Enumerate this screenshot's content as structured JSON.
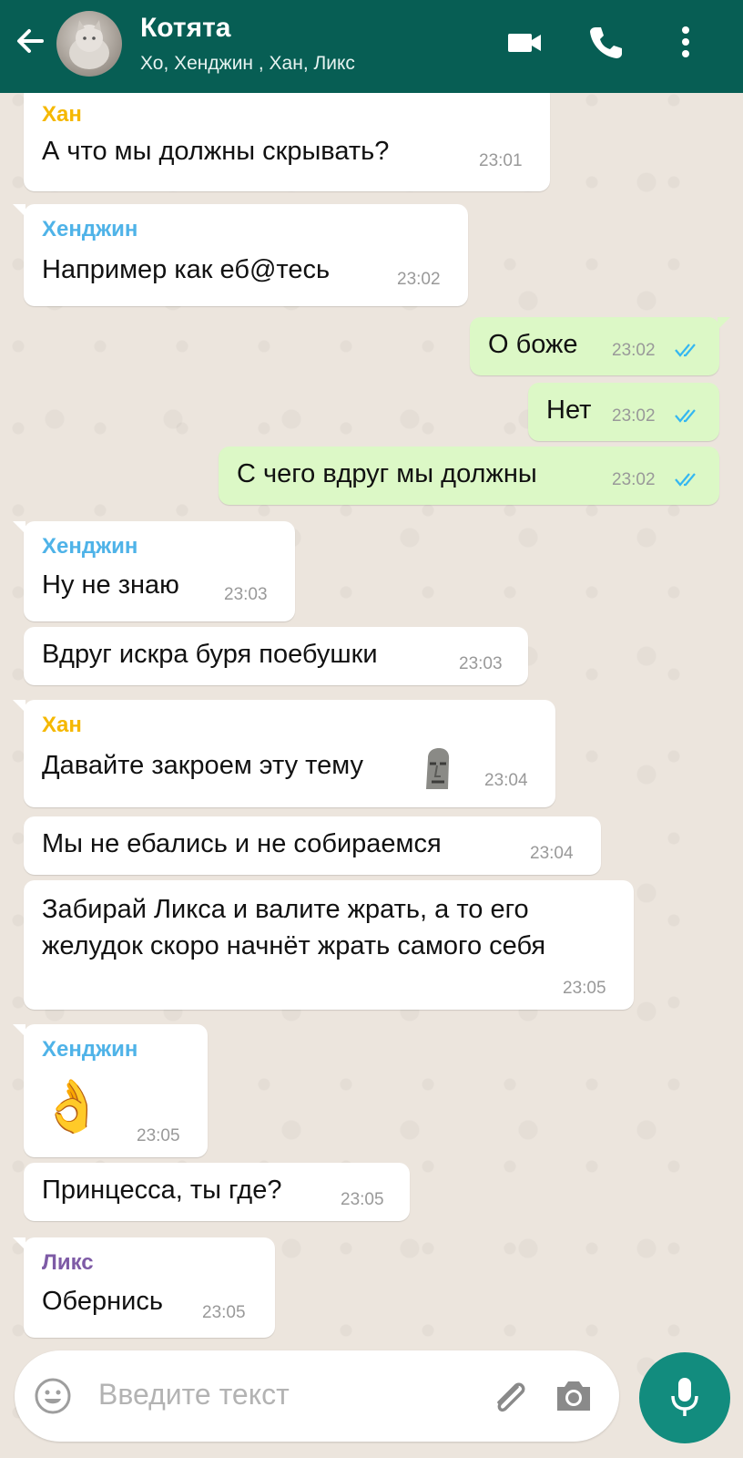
{
  "header": {
    "title": "Котята",
    "subtitle": "Хо, Хенджин , Хан, Ликс"
  },
  "colors": {
    "header": "#075E54",
    "outgoing": "#DCF8C6",
    "incoming": "#FFFFFF",
    "han": "#F5B800",
    "hyunjin": "#4FB3E8",
    "lix": "#7E5BA6",
    "read_ticks": "#34B7F1",
    "mic": "#128C7E"
  },
  "messages": [
    {
      "sender": "Хан",
      "text": "А что мы должны скрывать?",
      "time": "23:01"
    },
    {
      "sender": "Хенджин",
      "text": "Например как еб@тесь",
      "time": "23:02"
    },
    {
      "text": "О боже",
      "time": "23:02"
    },
    {
      "text": "Нет",
      "time": "23:02"
    },
    {
      "text": "С чего вдруг мы должны",
      "time": "23:02"
    },
    {
      "sender": "Хенджин",
      "text": "Ну не знаю",
      "time": "23:03"
    },
    {
      "text": "Вдруг искра буря поебушки",
      "time": "23:03"
    },
    {
      "sender": "Хан",
      "text": "Давайте закроем эту тему",
      "time": "23:04"
    },
    {
      "text": "Мы не ебались и не собираемся",
      "time": "23:04"
    },
    {
      "text": "Забирай Ликса и валите жрать, а то его желудок скоро начнёт жрать самого себя",
      "time": "23:05"
    },
    {
      "sender": "Хенджин",
      "emoji": "👌",
      "time": "23:05"
    },
    {
      "text": "Принцесса, ты где?",
      "time": "23:05"
    },
    {
      "sender": "Ликс",
      "text": "Обернись",
      "time": "23:05"
    }
  ],
  "input": {
    "placeholder": "Введите текст"
  },
  "icons": [
    "back-arrow-icon",
    "video-call-icon",
    "phone-icon",
    "more-icon",
    "emoji-icon",
    "attach-icon",
    "camera-icon",
    "mic-icon",
    "read-ticks-icon",
    "moai-icon"
  ]
}
